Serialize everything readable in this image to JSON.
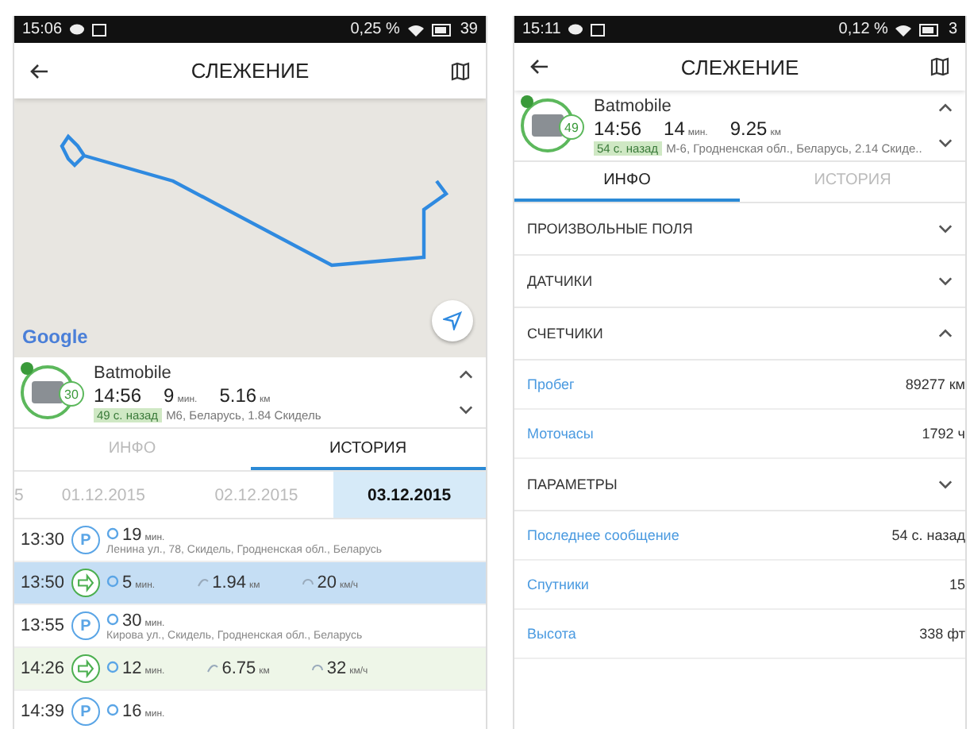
{
  "left_phone": {
    "status_bar": {
      "time": "15:06",
      "data_usage": "0,25 %",
      "battery": "39"
    },
    "header": {
      "title": "СЛЕЖЕНИЕ"
    },
    "map": {
      "logo": "Google"
    },
    "unit": {
      "name": "Batmobile",
      "speed": "30",
      "time": "14:56",
      "duration": "9",
      "duration_unit": "мин.",
      "distance": "5.16",
      "distance_unit": "км",
      "age": "49 с. назад",
      "location": "М6, Беларусь, 1.84 Скидель"
    },
    "tabs": [
      {
        "label": "ИНФО",
        "selected": false
      },
      {
        "label": "ИСТОРИЯ",
        "selected": true
      }
    ],
    "dates": [
      {
        "label": "5",
        "selected": false
      },
      {
        "label": "01.12.2015",
        "selected": false
      },
      {
        "label": "02.12.2015",
        "selected": false
      },
      {
        "label": "03.12.2015",
        "selected": true
      }
    ],
    "history": [
      {
        "kind": "parking",
        "time": "13:30",
        "icon_label": "P",
        "duration": "19",
        "duration_unit": "мин.",
        "address": "Ленина ул., 78, Скидель, Гродненская обл., Беларусь",
        "selected": false
      },
      {
        "kind": "trip",
        "time": "13:50",
        "duration": "5",
        "duration_unit": "мин.",
        "distance": "1.94",
        "distance_unit": "км",
        "speed": "20",
        "speed_unit": "км/ч",
        "selected": true
      },
      {
        "kind": "parking",
        "time": "13:55",
        "icon_label": "P",
        "duration": "30",
        "duration_unit": "мин.",
        "address": "Кирова ул., Скидель, Гродненская обл., Беларусь",
        "selected": false
      },
      {
        "kind": "trip",
        "time": "14:26",
        "duration": "12",
        "duration_unit": "мин.",
        "distance": "6.75",
        "distance_unit": "км",
        "speed": "32",
        "speed_unit": "км/ч",
        "selected": false
      },
      {
        "kind": "parking",
        "time": "14:39",
        "icon_label": "P",
        "duration": "16",
        "duration_unit": "мин.",
        "selected": false
      }
    ]
  },
  "right_phone": {
    "status_bar": {
      "time": "15:11",
      "data_usage": "0,12 %",
      "battery": "3"
    },
    "header": {
      "title": "СЛЕЖЕНИЕ"
    },
    "unit": {
      "name": "Batmobile",
      "speed": "49",
      "time": "14:56",
      "duration": "14",
      "duration_unit": "мин.",
      "distance": "9.25",
      "distance_unit": "км",
      "age": "54 с. назад",
      "location": "М-6, Гродненская обл., Беларусь, 2.14 Скиде.."
    },
    "tabs": [
      {
        "label": "ИНФО",
        "selected": true
      },
      {
        "label": "ИСТОРИЯ",
        "selected": false
      }
    ],
    "info": [
      {
        "kind": "section",
        "title": "ПРОИЗВОЛЬНЫЕ ПОЛЯ",
        "expanded": false
      },
      {
        "kind": "section",
        "title": "ДАТЧИКИ",
        "expanded": false
      },
      {
        "kind": "section",
        "title": "СЧЕТЧИКИ",
        "expanded": true
      },
      {
        "kind": "field",
        "label": "Пробег",
        "value": "89277 км"
      },
      {
        "kind": "field",
        "label": "Моточасы",
        "value": "1792 ч"
      },
      {
        "kind": "section",
        "title": "ПАРАМЕТРЫ",
        "expanded": false
      },
      {
        "kind": "field",
        "label": "Последнее сообщение",
        "value": "54 с. назад"
      },
      {
        "kind": "field",
        "label": "Спутники",
        "value": "15"
      },
      {
        "kind": "field",
        "label": "Высота",
        "value": "338 фт"
      }
    ]
  }
}
